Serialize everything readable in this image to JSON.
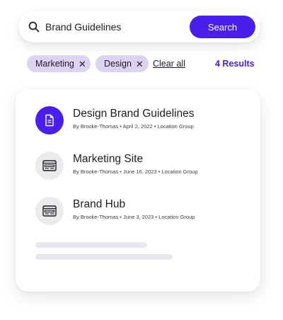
{
  "search": {
    "value": "Brand Guidelines",
    "button_label": "Search"
  },
  "filters": {
    "chips": [
      {
        "label": "Marketing",
        "remove": "✕"
      },
      {
        "label": "Design",
        "remove": "✕"
      }
    ],
    "clear_label": "Clear all",
    "result_count": "4 Results"
  },
  "results": [
    {
      "title": "Design Brand Guidelines",
      "meta": "By Brooke-Thomas • April 2, 2022 • Location Group",
      "icon": "document-icon",
      "active": true
    },
    {
      "title": "Marketing Site",
      "meta": "By Brooke-Thomas • June 16, 2023 • Location Group",
      "icon": "webpage-icon",
      "active": false
    },
    {
      "title": "Brand Hub",
      "meta": "By Brooke-Thomas • June 3, 2023 • Location Group",
      "icon": "webpage-icon",
      "active": false
    }
  ],
  "colors": {
    "accent": "#4a1fec",
    "chip_bg": "#dcd2f2",
    "icon_bg": "#ebebeb",
    "skeleton": "#e8e8ec"
  }
}
